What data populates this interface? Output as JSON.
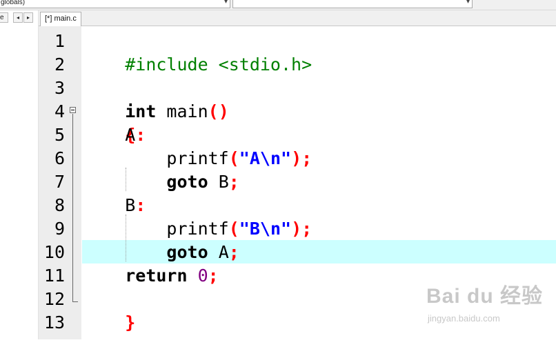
{
  "toolbar": {
    "scope_combo": "globals)",
    "function_combo": "",
    "combo_arrow": "▾"
  },
  "left_panel": {
    "tab_fragment": "e",
    "nav_left": "◂",
    "nav_right": "▸"
  },
  "editor": {
    "tab_label": "[*] main.c",
    "current_line": 10,
    "line_numbers": [
      "1",
      "2",
      "3",
      "4",
      "5",
      "6",
      "7",
      "8",
      "9",
      "10",
      "11",
      "12",
      "13"
    ],
    "code": {
      "l1": "#include <stdio.h>",
      "l3_kw": "int",
      "l3_name": " main",
      "l3_parens": "()",
      "l4_brace": "{",
      "l5_label": "A",
      "l5_colon": ":",
      "l6_fn": "printf",
      "l6_open": "(",
      "l6_str": "\"A\\n\"",
      "l6_close": ");",
      "l7_kw": "goto",
      "l7_target": " B",
      "l7_semi": ";",
      "l8_label": "B",
      "l8_colon": ":",
      "l9_fn": "printf",
      "l9_open": "(",
      "l9_str": "\"B\\n\"",
      "l9_close": ");",
      "l10_kw": "goto",
      "l10_target": " A",
      "l10_semi": ";",
      "l11_kw": "return",
      "l11_num": " 0",
      "l11_semi": ";",
      "l12_brace": "}"
    }
  },
  "watermark": {
    "logo": "Bai du 经验",
    "url": "jingyan.baidu.com"
  },
  "colors": {
    "preprocessor": "#008000",
    "keyword": "#000000",
    "symbol": "#ff0000",
    "string": "#0000ff",
    "number": "#800080",
    "current_line_bg": "#ccffff",
    "gutter_bg": "#ededed"
  }
}
